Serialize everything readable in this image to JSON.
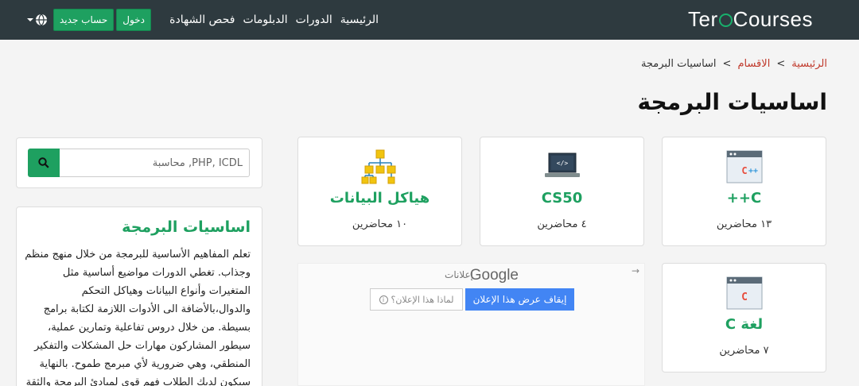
{
  "header": {
    "logo": {
      "prefix": "Ter",
      "suffix": "Courses"
    },
    "nav": [
      "الرئيسية",
      "الدورات",
      "الدبلومات",
      "فحص الشهادة"
    ],
    "login": "دخول",
    "register": "حساب جديد"
  },
  "breadcrumb": {
    "home": "الرئيسية",
    "sections": "الاقسام",
    "separator": ">",
    "current": "اساسيات البرمجة"
  },
  "page_title": "اساسيات البرمجة",
  "courses": [
    {
      "name": "C++",
      "count": "١٣ محاضرين",
      "icon": "cpp-code-window-icon"
    },
    {
      "name": "CS50",
      "count": "٤ محاضرين",
      "icon": "laptop-code-icon"
    },
    {
      "name": "هياكل البيانات",
      "count": "١٠ محاضرين",
      "icon": "data-structure-tree-icon"
    },
    {
      "name": "لغة C",
      "count": "٧ محاضرين",
      "icon": "c-code-window-icon"
    }
  ],
  "ad": {
    "brand": "Google",
    "label": "إعلانات",
    "stop": "إيقاف عرض هذا الإعلان",
    "why": "لماذا هذا الإعلان؟"
  },
  "search": {
    "placeholder": "PHP, ICDL, محاسبة"
  },
  "about": {
    "title": "اساسيات البرمجة",
    "text": "تعلم المفاهيم الأساسية للبرمجة من خلال منهج منظم وجذاب. تغطي الدورات مواضيع أساسية مثل المتغيرات وأنواع البيانات وهياكل التحكم والدوال،بالأضافة الى الأدوات اللازمة لكتابة برامج بسيطة. من خلال دروس تفاعلية وتمارين عملية، سيطور المشاركون مهارات حل المشكلات والتفكير المنطقي، وهي ضرورية لأي مبرمج طموح. بالنهاية سيكون لديك الطلاب فهم قوي لمبادئ البرمجة والثقة"
  },
  "colors": {
    "header_bg": "#2e3a3f",
    "accent": "#1ea060",
    "link": "#c0392b"
  }
}
